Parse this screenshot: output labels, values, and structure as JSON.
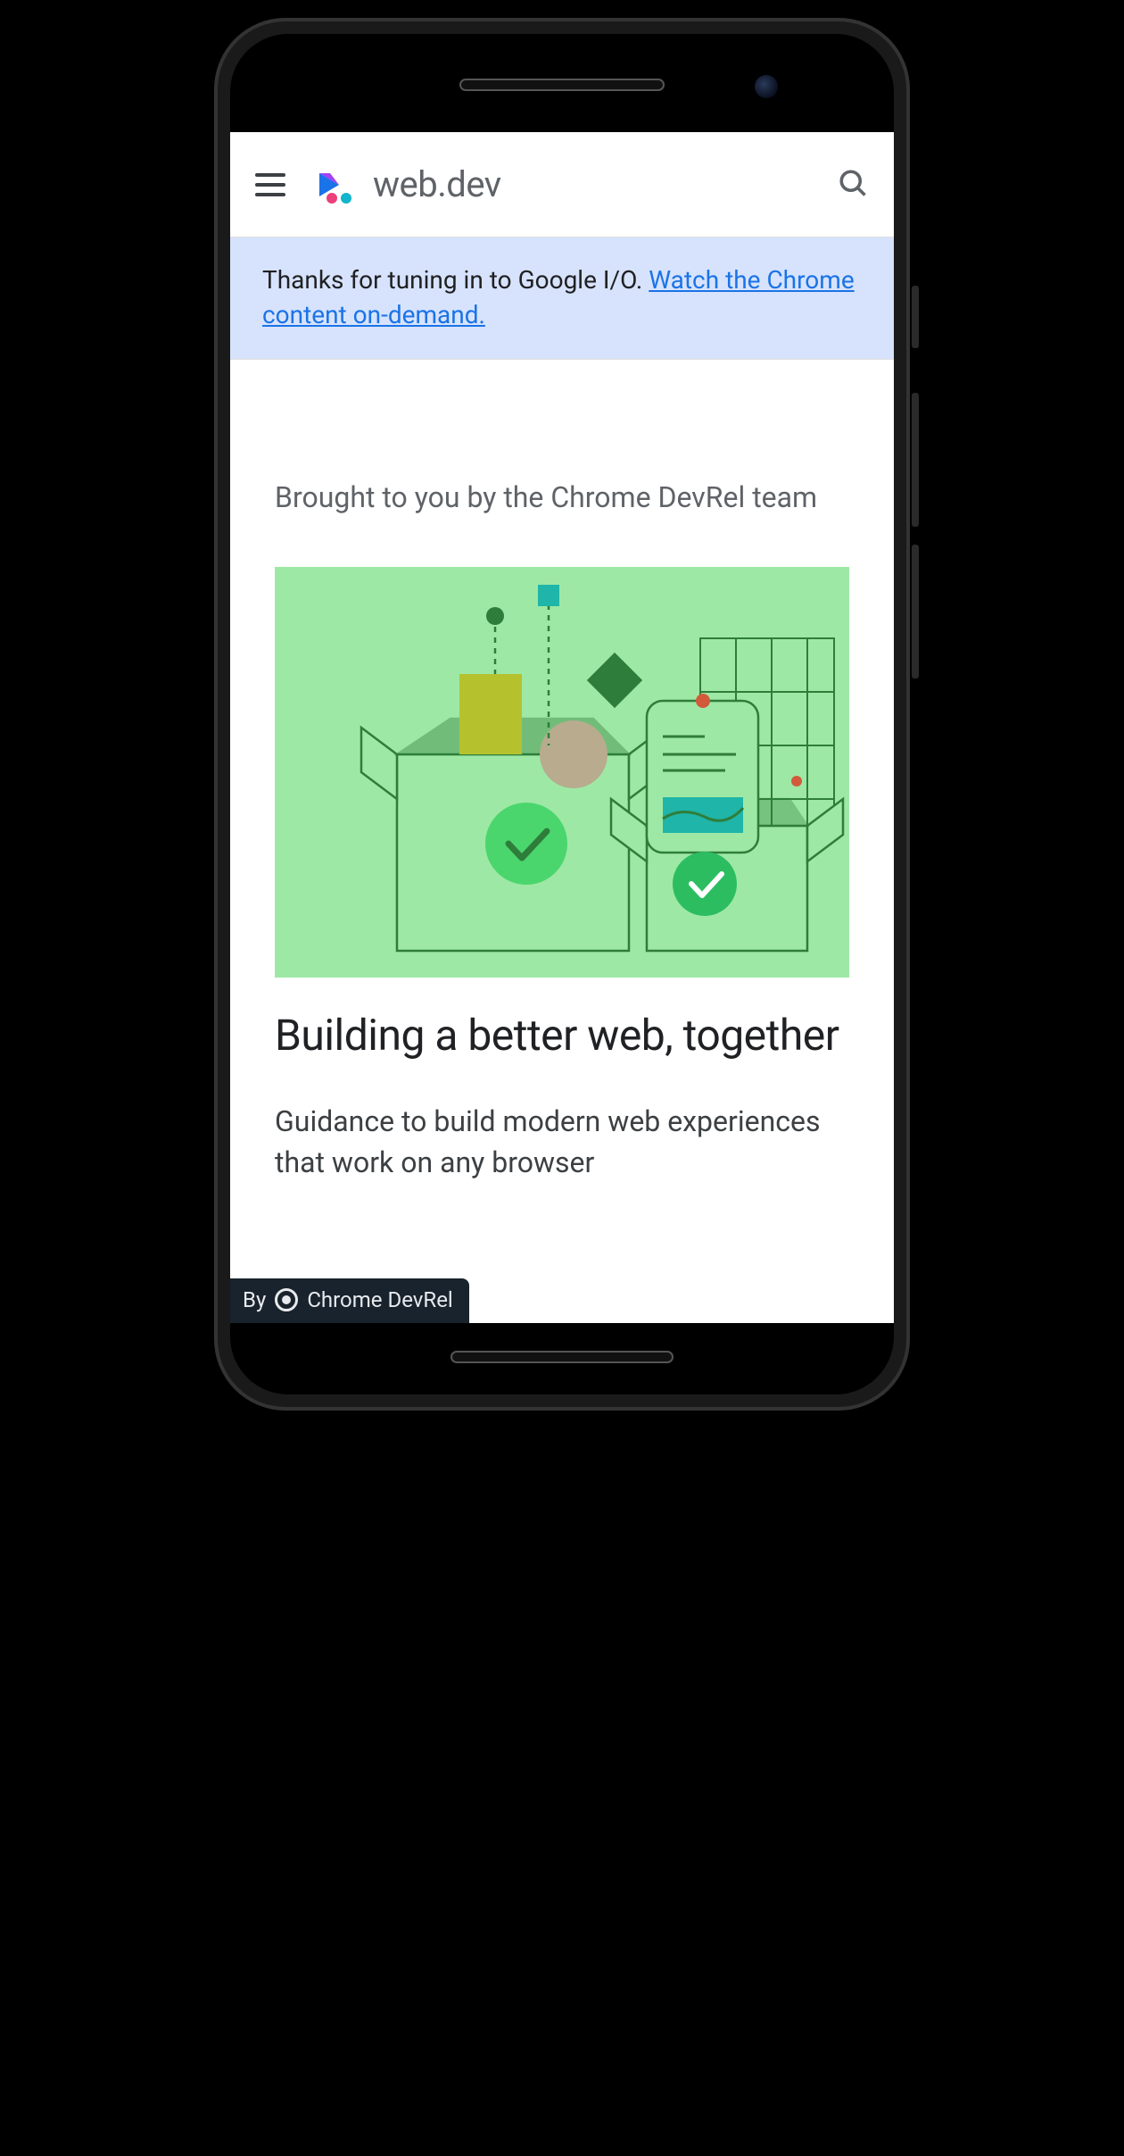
{
  "header": {
    "site_title": "web.dev"
  },
  "banner": {
    "text_before_link": "Thanks for tuning in to Google I/O. ",
    "link_text": "Watch the Chrome content on-demand."
  },
  "hero": {
    "kicker": "Brought to you by the Chrome DevRel team",
    "heading": "Building a better web, together",
    "subtext": "Guidance to build modern web experiences that work on any browser"
  },
  "badge": {
    "prefix": "By",
    "label": "Chrome DevRel"
  }
}
